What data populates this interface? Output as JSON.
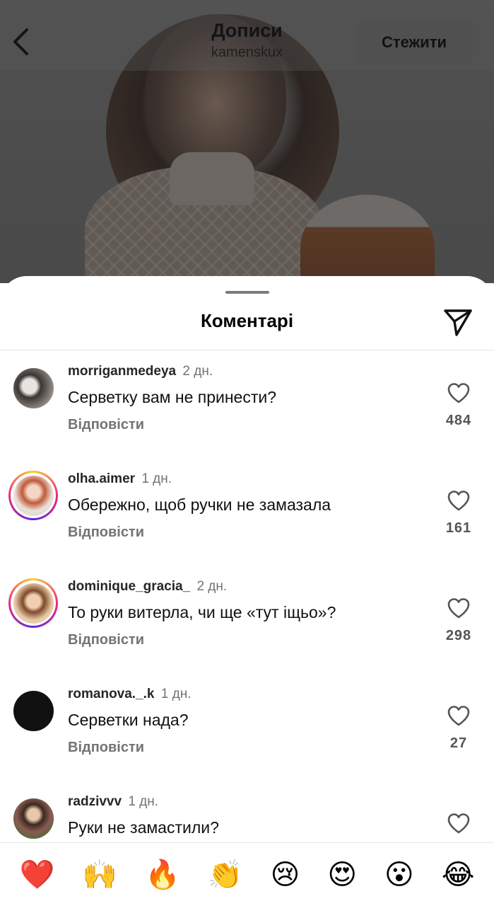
{
  "header": {
    "title": "Дописи",
    "subtitle": "kamenskux",
    "follow_label": "Стежити"
  },
  "sheet": {
    "title": "Коментарі"
  },
  "comments": [
    {
      "username": "morriganmedeya",
      "time": "2 дн.",
      "text": "Серветку вам не принести?",
      "reply_label": "Відповісти",
      "likes": "484",
      "has_story": false
    },
    {
      "username": "olha.aimer",
      "time": "1 дн.",
      "text": "Обережно, щоб ручки не замазала",
      "reply_label": "Відповісти",
      "likes": "161",
      "has_story": true
    },
    {
      "username": "dominique_gracia_",
      "time": "2 дн.",
      "text": "То руки витерла, чи ще «тут іщьо»?",
      "reply_label": "Відповісти",
      "likes": "298",
      "has_story": true
    },
    {
      "username": "romanova._.k",
      "time": "1 дн.",
      "text": "Серветки нада?",
      "reply_label": "Відповісти",
      "likes": "27",
      "has_story": false
    },
    {
      "username": "radzivvv",
      "time": "1 дн.",
      "text": "Руки не замастили?",
      "reply_label": "",
      "likes": "",
      "has_story": false
    }
  ],
  "emoji_bar": [
    {
      "emoji": "❤️",
      "icon": "red-heart-emoji"
    },
    {
      "emoji": "🙌",
      "icon": "raising-hands-emoji"
    },
    {
      "emoji": "🔥",
      "icon": "fire-emoji"
    },
    {
      "emoji": "👏",
      "icon": "clapping-hands-emoji"
    },
    {
      "emoji": "😢",
      "icon": "crying-face-emoji"
    },
    {
      "emoji": "😍",
      "icon": "heart-eyes-emoji"
    },
    {
      "emoji": "😮",
      "icon": "surprised-face-emoji"
    },
    {
      "emoji": "😂",
      "icon": "tears-of-joy-emoji"
    }
  ],
  "colors": {
    "text_secondary": "#737373",
    "divider": "#e6e6e6",
    "story_ring": "#ee2a7b"
  }
}
